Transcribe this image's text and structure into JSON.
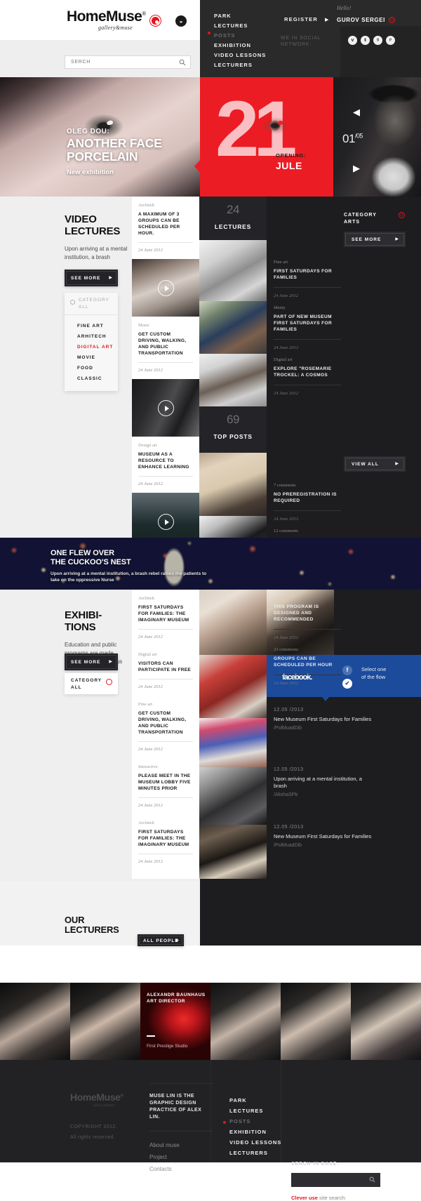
{
  "header": {
    "logo": "HomeMuse",
    "logo_reg": "®",
    "logo_sub": "gallery&muse",
    "search_placeholder": "SERCH",
    "search_value": "",
    "nav": [
      {
        "label": "PARK",
        "active": false
      },
      {
        "label": "LECTURES",
        "active": false
      },
      {
        "label": "POSTS",
        "active": true
      },
      {
        "label": "EXHIBITION",
        "active": false
      },
      {
        "label": "VIDEO LESSONS",
        "active": false
      },
      {
        "label": "LECTURERS",
        "active": false
      }
    ],
    "register": "REGISTER",
    "hello": "Hello!",
    "user": "GUROV SERGEI",
    "social_label": "WE IN\nSOCIAL NETWORK:",
    "social": [
      "v",
      "t",
      "g",
      "p"
    ]
  },
  "hero": {
    "kicker": "OLEG DOU:",
    "title": "ANOTHER FACE\nPORCELAIN",
    "subtitle": "New exhibition",
    "day": "21",
    "opening_label": "OPENING:",
    "opening_month": "JULE",
    "counter_current": "01",
    "counter_total": "/05"
  },
  "video_lectures": {
    "title": "VIDEO\nLECTURES",
    "description": "Upon arriving at a mental institution, a brash",
    "see_more": "SEE MORE",
    "category_label_1": "CATEGORY",
    "category_label_2": "ALL",
    "categories": [
      {
        "label": "FINE ART",
        "active": false
      },
      {
        "label": "ARHITECH",
        "active": false
      },
      {
        "label": "DIGITAL ART",
        "active": true
      },
      {
        "label": "MOVIE",
        "active": false
      },
      {
        "label": "FOOD",
        "active": false
      },
      {
        "label": "CLASSIC",
        "active": false
      }
    ],
    "news": [
      {
        "category": "Architeh",
        "title": "A MAXIMUM OF 3 GROUPS CAN BE SCHEDULED PER HOUR.",
        "date": "24 June  2012"
      },
      {
        "category": "Music",
        "title": "GET CUSTOM DRIVING, WALKING, AND PUBLIC TRANSPORTATION",
        "date": "24 June  2012"
      },
      {
        "category": "Design art",
        "title": "MUSEUM AS A RESOURCE TO ENHANCE LEARNING",
        "date": "24 June  2012"
      }
    ],
    "stats": [
      {
        "number": "24",
        "label": "LECTURES"
      },
      {
        "number": "69",
        "label": "TOP POSTS"
      }
    ],
    "side": {
      "category_title": "CATEGORY\nARTS",
      "see_more": "SEE MORE",
      "view_all": "VIEW ALL",
      "posts": [
        {
          "category": "Fine art",
          "title": "FIRST SATURDAYS FOR FAMILIES",
          "date": "24 June  2012"
        },
        {
          "category": "Identy",
          "title": "PART OF NEW MUSEUM FIRST SATURDAYS FOR FAMILIES",
          "date": "24 June  2012"
        },
        {
          "category": "Digital art",
          "title": "EXPLORE \"ROSEMARIE TROCKEL: A COSMOS",
          "date": "24 June  2012"
        }
      ],
      "top_posts": [
        {
          "category": "7 comments",
          "title": "NO PREREGISTRATION IS REQUIRED",
          "date": "24 June  2012"
        },
        {
          "category": "12 comments",
          "title": "THIS PROGRAM IS DESIGNED AND RECOMMENDED",
          "date": "24 June  2012"
        },
        {
          "category": "23 comments",
          "title": "GROUPS CAN BE SCHEDULED PER HOUR",
          "date": "24 June  2012"
        }
      ]
    }
  },
  "cuckoo": {
    "title": "ONE FLEW OVER\nTHE CUCKOO'S NEST",
    "text": "Upon arriving at a mental institution, a brash rebel rallies the patients to take on the oppressive Nurse"
  },
  "exhibitions": {
    "title": "EXHIBI-\nTIONS",
    "description": "Education and public programs are made possible by a generous",
    "see_more": "SEE MORE",
    "category_label_1": "CATEGORY",
    "category_label_2": "ALL",
    "news": [
      {
        "category": "Architeh",
        "title": "FIRST SATURDAYS FOR FAMILIES: THE IMAGINARY MUSEUM",
        "date": "24 June  2012"
      },
      {
        "category": "Digital art",
        "title": "VISITORS CAN PARTICIPATE IN FREE",
        "date": "24 June  2012"
      },
      {
        "category": "Fine art",
        "title": "GET CUSTOM DRIVING, WALKING, AND PUBLIC TRANSPORTATION",
        "date": "24 June  2012"
      },
      {
        "category": "Interactive",
        "title": "PLEASE MEET IN THE MUSEUM LOBBY FIVE MINUTES PRIOR",
        "date": "24 June  2012"
      },
      {
        "category": "Architeh",
        "title": "FIRST SATURDAYS FOR FAMILIES: THE IMAGINARY MUSEUM",
        "date": "24 June  2012"
      }
    ],
    "facebook": {
      "wordmark": "facebook",
      "wordmark_dot": ".",
      "select_text": "Select one\nof the flow"
    },
    "feed": [
      {
        "date": "12.05 /2013",
        "text": "New Museum First Saturdays for Families",
        "handle": "/PolMuadDib"
      },
      {
        "date": "12.05 /2013",
        "text": "Upon arriving at a mental institution, a brash",
        "handle": "/AlishaSPb"
      },
      {
        "date": "12.05 /2013",
        "text": "New Museum First Saturdays for Families",
        "handle": "/PolMuadDib"
      }
    ]
  },
  "lecturers": {
    "title": "OUR\nLECTURERS",
    "all_people": "ALL PEOPLE",
    "featured": {
      "name": "ALEXANDR BAUNHAUS\nART DIRECTOR",
      "studio": "First Prestige Studio"
    }
  },
  "footer": {
    "featured": {
      "name": "ALEXANDR BAUNHAUS\nART DIRECTOR",
      "studio": "First Prestige Studio"
    },
    "brand": "HomeMuse",
    "brand_reg": "®",
    "brand_sub": "gallery&muse",
    "copyright": "COPYRIGHT 2012.",
    "rights": "All rights reserved.",
    "tagline": "MUSE LIN IS THE GRAPHIC DESIGN PRACTICE OF ALEX LIN.",
    "links": [
      "About muse",
      "Project",
      "Contacts"
    ],
    "nav": [
      {
        "label": "PARK",
        "active": false
      },
      {
        "label": "LECTURES",
        "active": false
      },
      {
        "label": "POSTS",
        "active": true
      },
      {
        "label": "EXHIBITION",
        "active": false
      },
      {
        "label": "VIDEO LESSONS",
        "active": false
      },
      {
        "label": "LECTURERS",
        "active": false
      }
    ],
    "search_label": "SERCH IN BASE:",
    "search_value": "",
    "search_hint_accent": "Clever use",
    "search_hint_rest": " site search:"
  },
  "colors": {
    "accent_red": "#e8121b",
    "hero_red": "#ec1c24",
    "dark": "#1d1d1f",
    "facebook_blue": "#1c4b9c"
  }
}
